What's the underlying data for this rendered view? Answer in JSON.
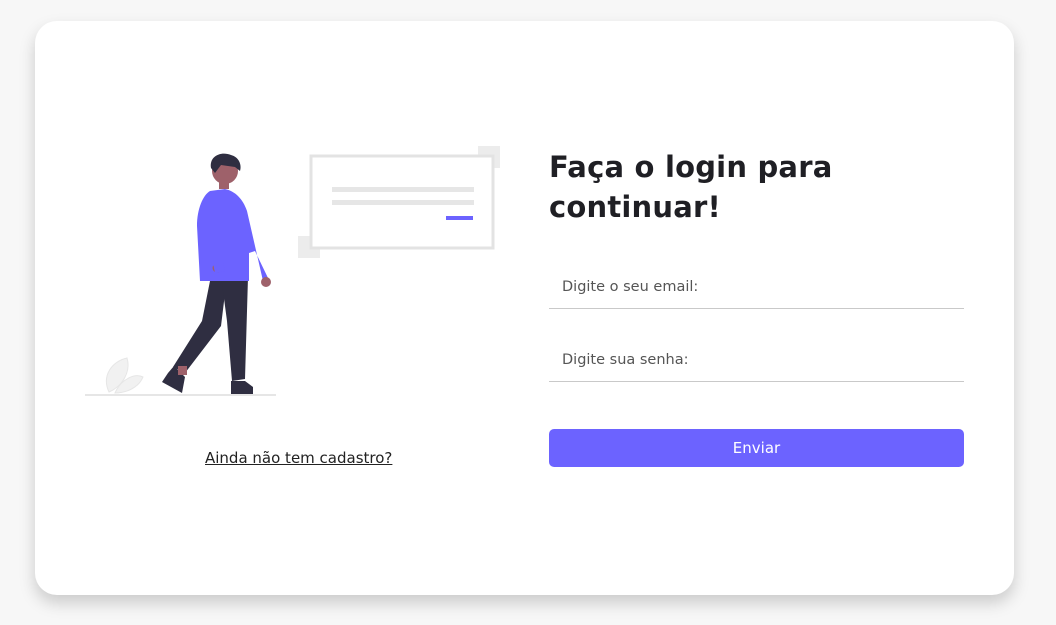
{
  "colors": {
    "accent": "#6c63ff",
    "background": "#f7f7f7",
    "card": "#ffffff",
    "heading": "#1f1f24"
  },
  "illustration": {
    "name": "person-walking-document-illustration"
  },
  "signup_link": {
    "label": "Ainda não tem cadastro?"
  },
  "form": {
    "heading": "Faça o login para continuar!",
    "email": {
      "placeholder": "Digite o seu email:",
      "value": ""
    },
    "password": {
      "placeholder": "Digite sua senha:",
      "value": ""
    },
    "submit_label": "Enviar"
  }
}
